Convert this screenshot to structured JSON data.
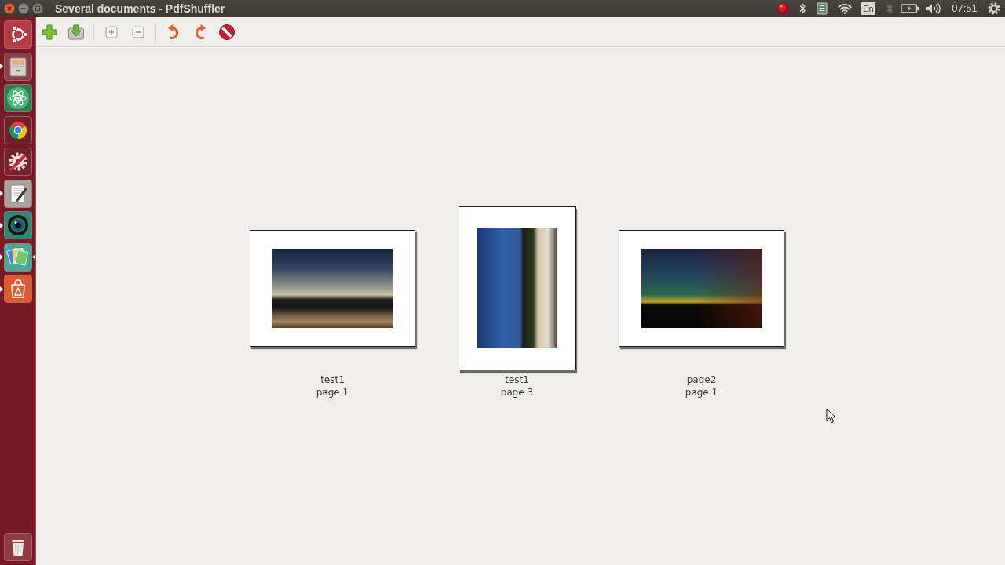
{
  "top_panel": {
    "window_controls": [
      {
        "kind": "close"
      },
      {
        "kind": "minimize"
      },
      {
        "kind": "maximize"
      }
    ],
    "window_title": "Several documents - PdfShuffler",
    "indicators": [
      {
        "kind": "record",
        "dimmed": false
      },
      {
        "kind": "bluetooth",
        "dimmed": false
      },
      {
        "kind": "notes",
        "dimmed": false
      },
      {
        "kind": "wifi",
        "dimmed": false
      },
      {
        "kind": "keyboard",
        "label": "En",
        "dimmed": false
      },
      {
        "kind": "bluetooth",
        "dimmed": true
      },
      {
        "kind": "battery",
        "dimmed": false
      },
      {
        "kind": "volume",
        "dimmed": false
      },
      {
        "kind": "clock",
        "label": "07:51",
        "dimmed": false
      },
      {
        "kind": "settings",
        "dimmed": false
      }
    ]
  },
  "launcher": {
    "items": [
      {
        "kind": "dash",
        "running": false,
        "focused": false
      },
      {
        "kind": "files",
        "running": true,
        "focused": false
      },
      {
        "kind": "atom",
        "running": false,
        "focused": false
      },
      {
        "kind": "browser",
        "running": false,
        "focused": false
      },
      {
        "kind": "tools",
        "running": false,
        "focused": false
      },
      {
        "kind": "editor",
        "running": true,
        "focused": false
      },
      {
        "kind": "lens",
        "running": true,
        "focused": false
      },
      {
        "kind": "shuffler",
        "running": true,
        "focused": true
      },
      {
        "kind": "software",
        "running": true,
        "focused": false
      },
      {
        "kind": "trash",
        "running": false,
        "focused": false
      }
    ]
  },
  "toolbar": {
    "groups": [
      {
        "buttons": [
          {
            "kind": "add"
          },
          {
            "kind": "export"
          }
        ]
      },
      {
        "buttons": [
          {
            "kind": "zoom-in"
          },
          {
            "kind": "zoom-out"
          }
        ]
      },
      {
        "buttons": [
          {
            "kind": "rotate-left"
          },
          {
            "kind": "rotate-right"
          },
          {
            "kind": "delete"
          }
        ]
      }
    ]
  },
  "pages": [
    {
      "kind": "landscape",
      "document": "test1",
      "page": "page 1"
    },
    {
      "kind": "portrait",
      "document": "test1",
      "page": "page 3"
    },
    {
      "kind": "landscape",
      "document": "page2",
      "page": "page 1"
    }
  ]
}
